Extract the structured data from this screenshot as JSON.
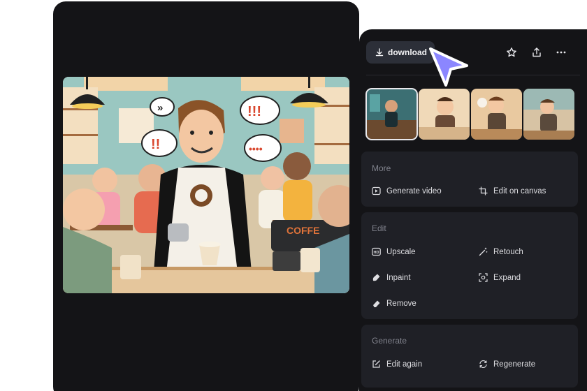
{
  "toolbar": {
    "download_label": "download",
    "icons": [
      "download-icon",
      "star-icon",
      "share-icon",
      "more-icon"
    ]
  },
  "thumbnails": [
    "barista-counter",
    "barista-smiling",
    "barista-pouring",
    "barista-kitchen"
  ],
  "more": {
    "title": "More",
    "items": [
      {
        "label": "Generate video",
        "icon": "play-icon"
      },
      {
        "label": "Edit on canvas",
        "icon": "crop-icon"
      }
    ]
  },
  "edit": {
    "title": "Edit",
    "items": [
      {
        "label": "Upscale",
        "icon": "hd-icon"
      },
      {
        "label": "Retouch",
        "icon": "magic-wand-icon"
      },
      {
        "label": "Inpaint",
        "icon": "inpaint-icon"
      },
      {
        "label": "Expand",
        "icon": "expand-icon"
      },
      {
        "label": "Remove",
        "icon": "eraser-icon"
      }
    ]
  },
  "generate": {
    "title": "Generate",
    "items": [
      {
        "label": "Edit again",
        "icon": "edit-icon"
      },
      {
        "label": "Regenerate",
        "icon": "regenerate-icon"
      }
    ]
  },
  "main_image": {
    "bubbles": [
      "»",
      "!!!",
      "!!",
      "••••"
    ],
    "sign": "COFFE"
  },
  "colors": {
    "accent": "#8b86ff",
    "panel": "#141417",
    "card": "#1f2026",
    "button": "#2c2f38"
  }
}
